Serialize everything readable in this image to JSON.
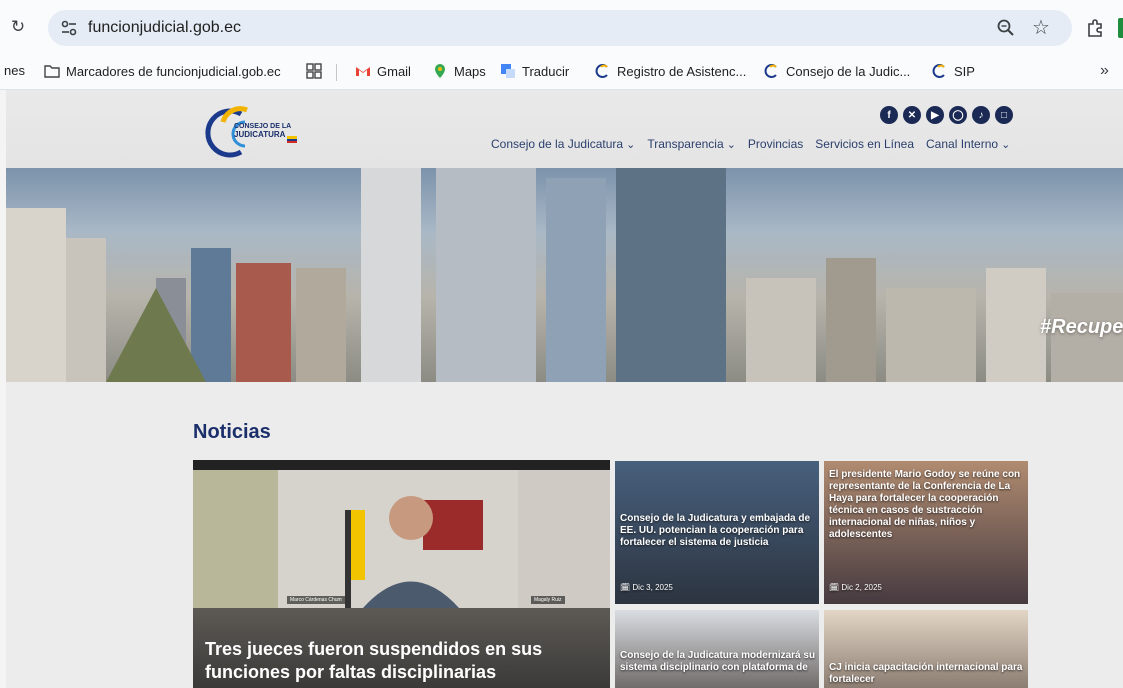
{
  "browser": {
    "url": "funcionjudicial.gob.ec",
    "bookmarks": [
      {
        "label": "nes",
        "icon": "truncated-item"
      },
      {
        "label": "Marcadores de funcionjudicial.gob.ec",
        "icon": "folder-icon"
      },
      {
        "label": "",
        "icon": "apps-grid-icon"
      },
      {
        "label": "Gmail",
        "icon": "gmail-icon"
      },
      {
        "label": "Maps",
        "icon": "maps-pin-icon"
      },
      {
        "label": "Traducir",
        "icon": "translate-icon"
      },
      {
        "label": "Registro de Asistenc...",
        "icon": "site-favicon"
      },
      {
        "label": "Consejo de la Judic...",
        "icon": "site-favicon"
      },
      {
        "label": "SIP",
        "icon": "site-favicon"
      }
    ],
    "overflow": "»"
  },
  "site": {
    "logo": {
      "line1": "CONSEJO DE LA",
      "line2": "JUDICATURA"
    },
    "socials": [
      "facebook-icon",
      "x-icon",
      "youtube-icon",
      "instagram-icon",
      "tiktok-icon",
      "spaces-icon"
    ],
    "nav": [
      {
        "label": "Consejo de la Judicatura",
        "dropdown": true
      },
      {
        "label": "Transparencia",
        "dropdown": true
      },
      {
        "label": "Provincias",
        "dropdown": false
      },
      {
        "label": "Servicios en Línea",
        "dropdown": false
      },
      {
        "label": "Canal Interno",
        "dropdown": true
      }
    ],
    "hero_tag": "#Recupe",
    "news_heading": "Noticias",
    "main_news": {
      "headline": "Tres jueces fueron suspendidos en sus funciones por faltas disciplinarias",
      "name_left": "Marco Cárdenas Chum",
      "name_right": "Magaly Ruiz"
    },
    "side_news": [
      {
        "title": "Consejo de la Judicatura y embajada de EE. UU. potencian la cooperación para fortalecer el sistema de justicia",
        "date": "Dic 3, 2025"
      },
      {
        "title": "El presidente Mario Godoy se reúne con representante de la Conferencia de La Haya para fortalecer la cooperación técnica en casos de sustracción internacional de niñas, niños y adolescentes",
        "date": "Dic 2, 2025"
      },
      {
        "title": "Consejo de la Judicatura modernizará su sistema disciplinario con plataforma de",
        "date": ""
      },
      {
        "title": "CJ inicia capacitación internacional para fortalecer",
        "date": ""
      }
    ]
  }
}
